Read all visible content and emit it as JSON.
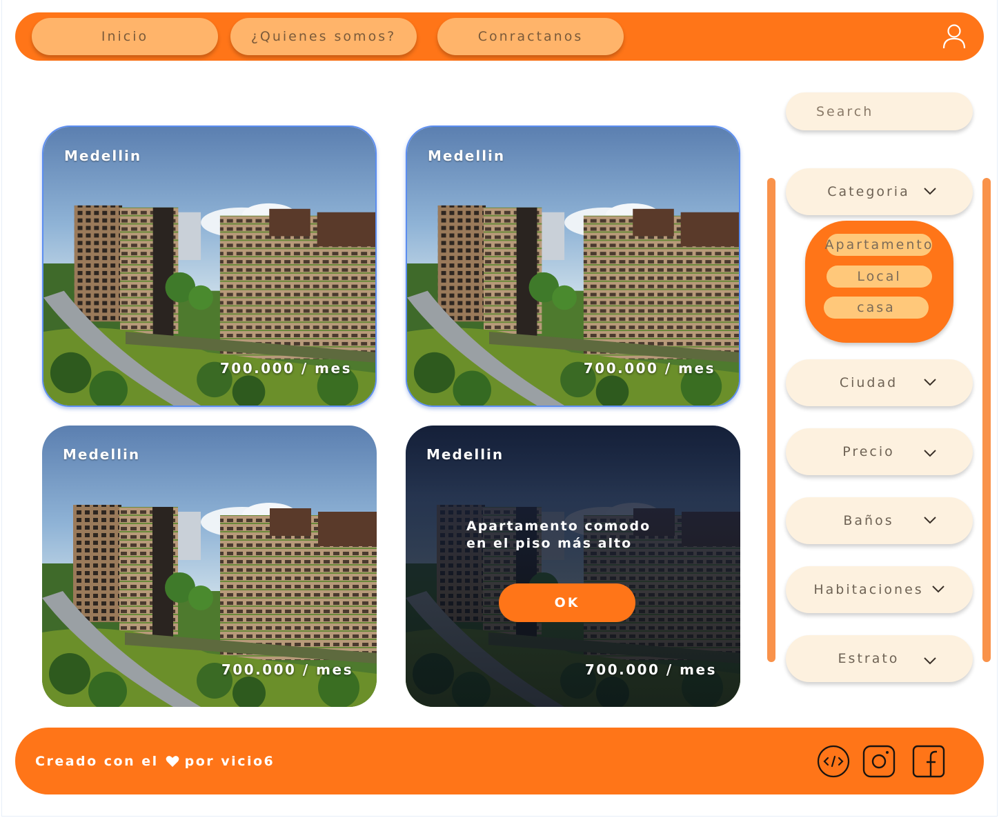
{
  "nav": {
    "items": [
      "Inicio",
      "¿Quienes somos?",
      "Conractanos"
    ],
    "user_icon": "user-icon"
  },
  "listings": [
    {
      "city": "Medellin",
      "price": "700.000 / mes",
      "selected": true
    },
    {
      "city": "Medellin",
      "price": "700.000 / mes",
      "selected": true
    },
    {
      "city": "Medellin",
      "price": "700.000 / mes",
      "selected": false
    },
    {
      "city": "Medellin",
      "price": "700.000 / mes",
      "selected": false,
      "overlay": {
        "description_line1": "Apartamento comodo",
        "description_line2": "en el piso más alto",
        "button": "OK"
      }
    }
  ],
  "sidebar": {
    "search_placeholder": "Search",
    "filters": {
      "categoria": "Categoria",
      "ciudad": "Ciudad",
      "precio": "Precio",
      "banos": "Baños",
      "habitaciones": "Habitaciones",
      "estrato": "Estrato"
    },
    "categoria_options": [
      "Apartamento",
      "Local",
      "casa"
    ]
  },
  "footer": {
    "credit_before": "Creado con el",
    "credit_after": "por vicio6",
    "social_icons": [
      "code-icon",
      "instagram-icon",
      "facebook-icon"
    ]
  },
  "colors": {
    "brand_orange": "#ff7518",
    "nav_button": "#ffb46a",
    "sidebar_pill": "#fdf1df",
    "option_pill": "#ffc87a",
    "selection_border": "#5b8df0"
  }
}
